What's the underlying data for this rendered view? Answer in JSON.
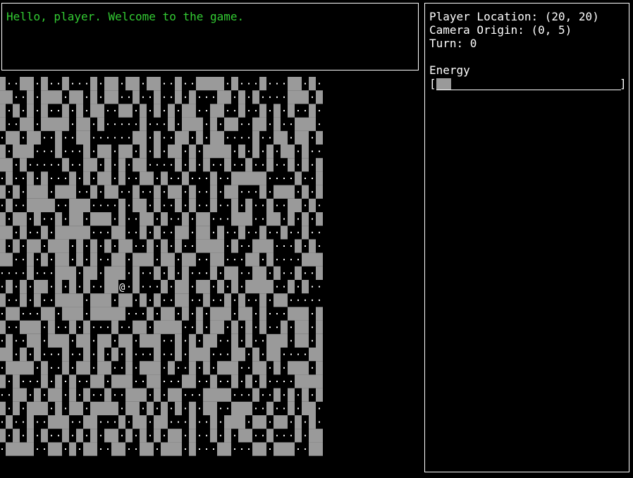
{
  "messages": {
    "lines": [
      "Hello, player. Welcome to the game."
    ],
    "color": "#33cc33"
  },
  "status": {
    "player_location_label": "Player Location: (20, 20)",
    "camera_origin_label": "Camera Origin: (0, 5)",
    "turn_label": "Turn: 0",
    "energy_label": "Energy",
    "energy_fraction": 0.08,
    "bar_open": "[",
    "bar_close": "]"
  },
  "map": {
    "player_glyph": "@",
    "wall_color": "#9a9a9a",
    "floor_color": "#ffffff",
    "background": "#000000",
    "player_cell": [
      20,
      15
    ],
    "rows": [
      "#..##.#..#...#.##.##.##..#..####.#...#...##.#.",
      "##..#.###.##.#.##..#..#..#.#...##.#.#....###.#",
      "#.#.#.#..#.#.##..##.#.#.#.##..##..#..#.#.#..#.",
      "#..##.####.##.#.....#...#.###.#.##..##.#..###.",
      ".##.##..#..##......##.#..##.#.##....#..##.##.#",
      "#.###...#...#.##.##.#.#.##.#.####.#.#.#.##.#..",
      "##.#.....#..##.#.#.##....#.#.#..#..#..#..#.#.#",
      ".#..#.#...#.#.##.#..##.#..#...#..#####....#..#",
      "#.#.###.###..#.##..#..#.##.#..#.##...#.###.#.#",
      ".#..####..###....#.##.#..#.#..#..#.#..#..##.#.",
      "#.##.#..#.##.###.#..##.#..#.##...###..##.#.#.#",
      "##.#..#.#####...##..#.#..##.##.#..#..#..#..#..",
      "#.#.##.###.#.#.#.##..#.#.#..####.#..###...#.#.",
      "##..#.#.##.#.#..##.###.##.##..##...##.#....###",
      "....#...###.##.###.#..#.#.#...#.##..##.#..#..#",
      ".#.#.##.#.#.#..##@.#...#.##.##.#.#.####..#.#..",
      "#..#.#..####.###.##.#.#..##..#..#.#..#.##.....",
      ".##...##.###.#####...#.##.#.#.###.##.#...###.#",
      "#..###.#..#.#...#..##.####..#.##.#.#.#..#.##.#",
      ".#..##.###.##.##.##.###..#.#.##..#.#..###.##.#",
      "##.#.#...#..#.#.#.#...#..#.###...##.#.##....##",
      ".####.#..#.##.##..#.###.#..#.#.###..##.#.###.#",
      "#.#...#.#.#..##.###..##...##..#..#.#.#....####",
      "..##.#.##.#.#..#..###.#.##...####...#..#.#.#.#",
      "#.#.###.#.##.####.##.#.#.#.#.##..###..#..#.##.",
      ".#..#..###..##...#.##.##...#..#.###.##.##.#.#.",
      "#.#.#.#..#.#.#.##.#.#.#.##.#..#.#.##..#...#.##",
      ".####..##.#.##..##..##.###.#...##...##.###..##"
    ]
  }
}
